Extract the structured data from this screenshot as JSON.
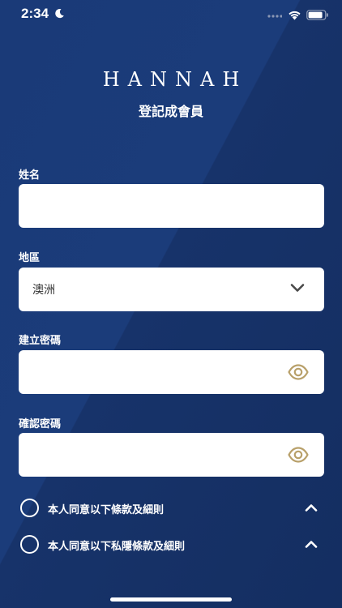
{
  "status_bar": {
    "time": "2:34",
    "icons": [
      "moon-icon",
      "signal-icon",
      "wifi-icon",
      "battery-icon"
    ]
  },
  "header": {
    "brand": "HANNAH",
    "title": "登記成會員"
  },
  "form": {
    "name": {
      "label": "姓名",
      "value": ""
    },
    "region": {
      "label": "地區",
      "value": "澳洲"
    },
    "password": {
      "label": "建立密碼",
      "value": ""
    },
    "confirm_password": {
      "label": "確認密碼",
      "value": ""
    }
  },
  "agreements": [
    {
      "label": "本人同意以下條款及細則",
      "checked": false
    },
    {
      "label": "本人同意以下私隱條款及細則",
      "checked": false
    }
  ],
  "colors": {
    "background": "#1b3a73",
    "accent_gold": "#b8a06a",
    "field_bg": "#ffffff"
  }
}
